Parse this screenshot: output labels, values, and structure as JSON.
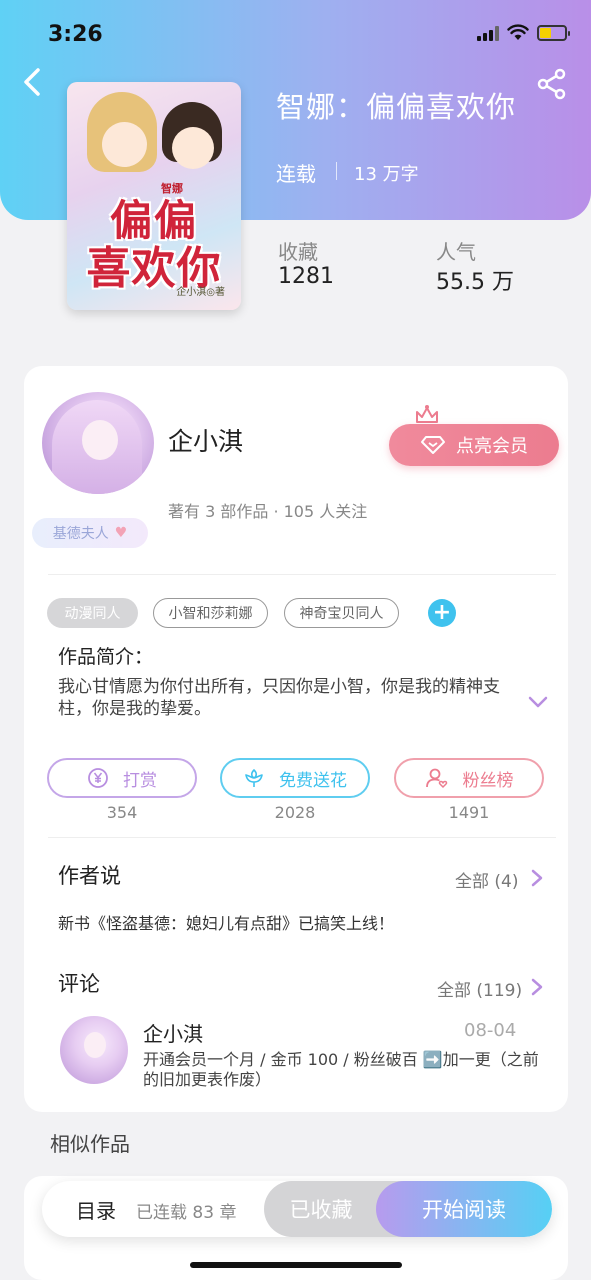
{
  "status_bar": {
    "time": "3:26"
  },
  "book": {
    "cover_title_line1": "偏偏",
    "cover_title_line2": "喜欢你",
    "cover_tag": "智娜",
    "cover_author": "企小淇◎著",
    "title": "智娜：偏偏喜欢你",
    "status": "连载",
    "word_count": "13 万字",
    "stats": [
      {
        "label": "收藏",
        "value": "1281"
      },
      {
        "label": "人气",
        "value": "55.5 万"
      }
    ]
  },
  "author": {
    "name": "企小淇",
    "badge": "基德夫人",
    "meta": "著有 3 部作品 · 105 人关注",
    "vip_button": "点亮会员"
  },
  "tags": {
    "items": [
      "动漫同人",
      "小智和莎莉娜",
      "神奇宝贝同人"
    ],
    "add_symbol": "+"
  },
  "intro": {
    "label": "作品简介：",
    "text": "我心甘情愿为你付出所有，只因你是小智，你是我的精神支柱，你是我的挚爱。"
  },
  "actions": [
    {
      "label": "打赏",
      "icon": "yen-coin-icon",
      "count": "354",
      "color": "#b88ee0"
    },
    {
      "label": "免费送花",
      "icon": "flower-icon",
      "count": "2028",
      "color": "#3fc2ee"
    },
    {
      "label": "粉丝榜",
      "icon": "fan-person-icon",
      "count": "1491",
      "color": "#ec7c8f"
    }
  ],
  "author_says": {
    "title": "作者说",
    "more": "全部 (4)",
    "announcement": "新书《怪盗基德：媳妇儿有点甜》已搞笑上线！"
  },
  "comments": {
    "title": "评论",
    "more": "全部 (119)",
    "items": [
      {
        "user": "企小淇",
        "date": "08-04",
        "text": "开通会员一个月 / 金币 100 / 粉丝破百 ➡️加一更（之前的旧加更表作废）"
      }
    ]
  },
  "similar": {
    "title": "相似作品"
  },
  "bottom_bar": {
    "toc": "目录",
    "chapters": "已连载 83 章",
    "collected": "已收藏",
    "read": "开始阅读"
  },
  "colors": {
    "header_gradient_start": "#5fd1f5",
    "header_gradient_end": "#b98fe8",
    "vip": "#ec7c8f",
    "accent_blue": "#3fc2ee",
    "accent_purple": "#b88ee0"
  }
}
